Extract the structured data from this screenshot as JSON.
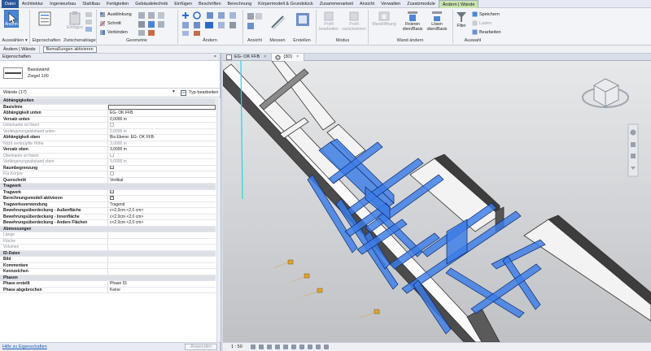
{
  "menu": [
    "Datei",
    "Architektur",
    "Ingenieurbau",
    "Stahlbau",
    "Fertigteilen",
    "Gebäudetechnik",
    "Einfügen",
    "Beschriften",
    "Berechnung",
    "Körpermodell & Grundstück",
    "Zusammenarbeit",
    "Ansicht",
    "Verwalten",
    "Zusatzmodule",
    "Ändern | Wände"
  ],
  "ribbon": {
    "modify_label": "Ändern",
    "properties_label": "Eigenschaften",
    "paste_label": "Einfügen",
    "select_panel": "Auswählen ▾",
    "properties_panel": "Eigenschaften",
    "clipboard_panel": "Zwischenablage",
    "geometry_panel": "Geometrie",
    "modify_panel": "Ändern",
    "view_panel": "Ansicht",
    "measure_panel": "Messen",
    "create_panel": "Erstellen",
    "mode_panel": "Modus",
    "wall_panel": "Wand ändern",
    "selection_panel": "Auswahl",
    "cope_label": "Ausklinkung",
    "cut_label": "Schnitt",
    "join_label": "Verbinden",
    "profile_edit": [
      "Profil",
      "bearbeiten"
    ],
    "profile_reset": [
      "Profil",
      "zurücksetzen"
    ],
    "wall_opening": "Wandöffnung",
    "attach": [
      "Fixieren",
      "oben/Basis"
    ],
    "detach": [
      "Lösen",
      "oben/Basis"
    ],
    "filter": "Filter",
    "save": "Speichern",
    "load": "Laden",
    "edit": "Bearbeiten"
  },
  "ctxbar": {
    "label": "Ändern | Wände",
    "button": "Bemaßungen aktivieren"
  },
  "props": {
    "title": "Eigenschaften",
    "close": "×",
    "family": "Basiswand",
    "type": "Ziegel 100",
    "filter": "Wände (17)",
    "edit_type": "Typ bearbeiten",
    "help": "Hilfe zu Eigenschaften",
    "apply": "Anwenden",
    "rows": [
      {
        "kind": "sec",
        "k": "Abhängigkeiten"
      },
      {
        "kind": "bold",
        "k": "Basislinie",
        "v": ""
      },
      {
        "kind": "bold",
        "k": "Abhängigkeit unten",
        "v": "EG- OK FFB"
      },
      {
        "kind": "bold",
        "k": "Versatz unten",
        "v": "0,0000 m"
      },
      {
        "kind": "muted",
        "k": "Unterkante ist fixiert",
        "cb": "dim"
      },
      {
        "kind": "muted",
        "k": "Verlängerungsabstand unten",
        "v": "0,0000 m"
      },
      {
        "kind": "bold",
        "k": "Abhängigkeit oben",
        "v": "Bis Ebene: EG- OK FFB"
      },
      {
        "kind": "muted",
        "k": "Nicht verknüpfte Höhe",
        "v": "3,0000 m"
      },
      {
        "kind": "bold",
        "k": "Versatz oben",
        "v": "3,0000 m"
      },
      {
        "kind": "muted",
        "k": "Oberkante ist fixiert.",
        "cb": "dim"
      },
      {
        "kind": "muted",
        "k": "Verlängerungsabstand oben",
        "v": "0,0000 m"
      },
      {
        "kind": "bold",
        "k": "Raumbegrenzung",
        "cb": "on"
      },
      {
        "kind": "muted",
        "k": "Für Körper",
        "cb": "dim"
      },
      {
        "kind": "bold",
        "k": "Querschnitt",
        "v": "Vertikal"
      },
      {
        "kind": "sec",
        "k": "Tragwerk"
      },
      {
        "kind": "bold",
        "k": "Tragwerk",
        "cb": "on"
      },
      {
        "kind": "bold",
        "k": "Berechnungsmodell aktivieren",
        "cb": "on"
      },
      {
        "kind": "bold",
        "k": "Tragwerksverwendung",
        "v": "Tragend"
      },
      {
        "kind": "bold",
        "k": "Bewehrungsüberdeckung - Außenfläche",
        "v": "c<2,0cm <2,0 cm>"
      },
      {
        "kind": "bold",
        "k": "Bewehrungsüberdeckung - Innenfläche",
        "v": "c<2,0cm <2,0 cm>"
      },
      {
        "kind": "bold",
        "k": "Bewehrungsüberdeckung - Andere Flächen",
        "v": "c<2,0cm <2,0 cm>"
      },
      {
        "kind": "sec",
        "k": "Abmessungen"
      },
      {
        "kind": "muted",
        "k": "Länge",
        "v": ""
      },
      {
        "kind": "muted",
        "k": "Fläche",
        "v": ""
      },
      {
        "kind": "muted",
        "k": "Volumen",
        "v": ""
      },
      {
        "kind": "sec",
        "k": "ID-Daten"
      },
      {
        "kind": "bold",
        "k": "Bild",
        "v": ""
      },
      {
        "kind": "bold",
        "k": "Kommentare",
        "v": ""
      },
      {
        "kind": "bold",
        "k": "Kennzeichen",
        "v": ""
      },
      {
        "kind": "sec",
        "k": "Phasen"
      },
      {
        "kind": "bold",
        "k": "Phase erstellt",
        "v": "Phase 01"
      },
      {
        "kind": "bold",
        "k": "Phase abgebrochen",
        "v": "Keine"
      }
    ]
  },
  "view": {
    "tabs": [
      "EG- OK FFB",
      "{3D}"
    ],
    "scale": "1 : 50",
    "wall_color": "#3c7de6"
  }
}
